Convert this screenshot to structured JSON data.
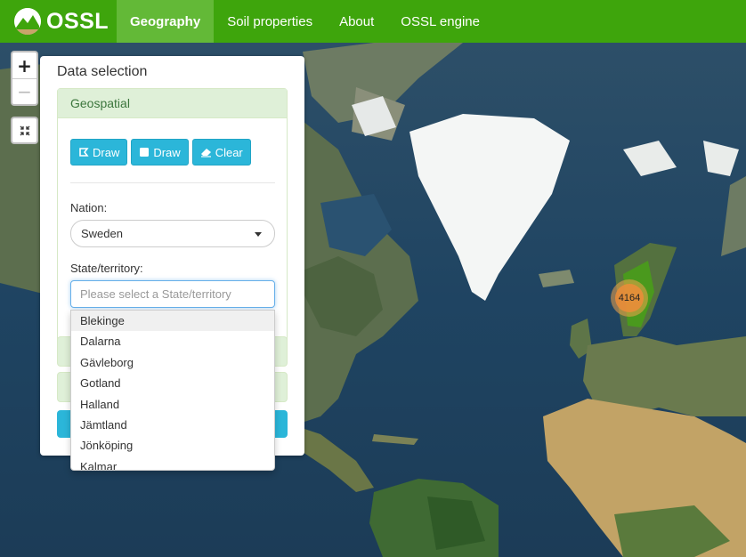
{
  "navbar": {
    "brand": "OSSL",
    "items": [
      {
        "label": "Geography",
        "active": true
      },
      {
        "label": "Soil properties",
        "active": false
      },
      {
        "label": "About",
        "active": false
      },
      {
        "label": "OSSL engine",
        "active": false
      }
    ],
    "color": "#3ea50c"
  },
  "map": {
    "zoom_in": "+",
    "zoom_out": "−",
    "cluster_count": "4164"
  },
  "panel": {
    "title": "Data selection",
    "geospatial": {
      "header": "Geospatial",
      "buttons": {
        "draw_polygon": "Draw",
        "draw_rectangle": "Draw",
        "clear": "Clear"
      },
      "nation_label": "Nation:",
      "nation_value": "Sweden",
      "state_label": "State/territory:",
      "state_placeholder": "Please select a State/territory"
    },
    "state_options": [
      "Blekinge",
      "Dalarna",
      "Gävleborg",
      "Gotland",
      "Halland",
      "Jämtland",
      "Jönköping",
      "Kalmar"
    ],
    "highlighted_option": "Blekinge"
  },
  "colors": {
    "button": "#2bb6d9",
    "header_bg": "#dff0d8",
    "header_text": "#3c763d"
  }
}
